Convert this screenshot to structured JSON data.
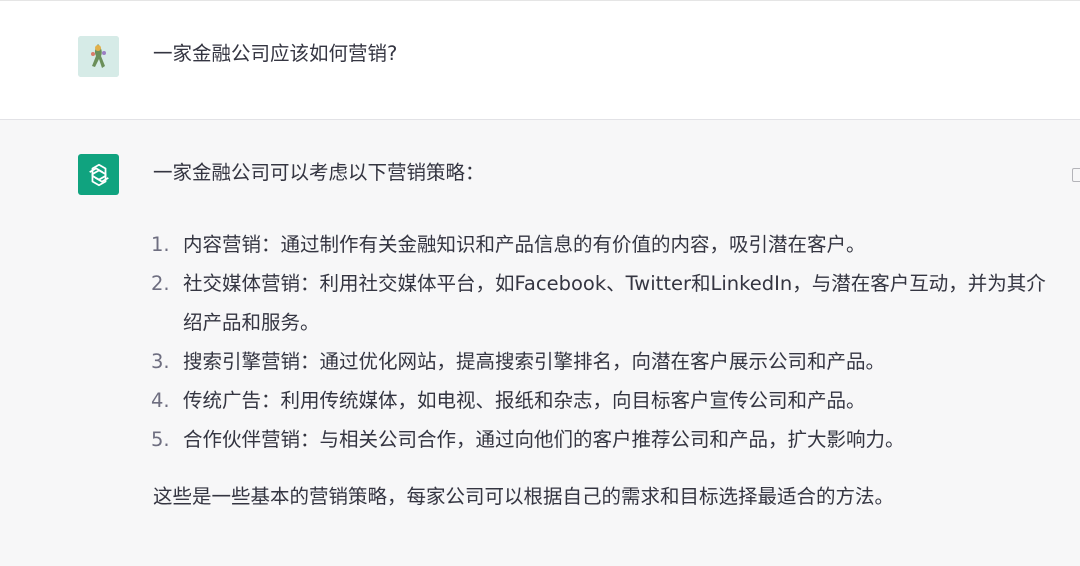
{
  "user_message": {
    "text": "一家金融公司应该如何营销?"
  },
  "assistant_message": {
    "intro": "一家金融公司可以考虑以下营销策略：",
    "items": [
      {
        "num": "1.",
        "text": "内容营销：通过制作有关金融知识和产品信息的有价值的内容，吸引潜在客户。"
      },
      {
        "num": "2.",
        "text": "社交媒体营销：利用社交媒体平台，如Facebook、Twitter和LinkedIn，与潜在客户互动，并为其介绍产品和服务。"
      },
      {
        "num": "3.",
        "text": "搜索引擎营销：通过优化网站，提高搜索引擎排名，向潜在客户展示公司和产品。"
      },
      {
        "num": "4.",
        "text": "传统广告：利用传统媒体，如电视、报纸和杂志，向目标客户宣传公司和产品。"
      },
      {
        "num": "5.",
        "text": "合作伙伴营销：与相关公司合作，通过向他们的客户推荐公司和产品，扩大影响力。"
      }
    ],
    "outro": "这些是一些基本的营销策略，每家公司可以根据自己的需求和目标选择最适合的方法。"
  },
  "colors": {
    "assistant_bg": "#f7f7f8",
    "bot_avatar_bg": "#10a37f",
    "text": "#343541"
  },
  "icons": {
    "user_avatar": "user-avatar-image",
    "bot_avatar": "openai-logo-icon",
    "copy": "copy-icon"
  }
}
